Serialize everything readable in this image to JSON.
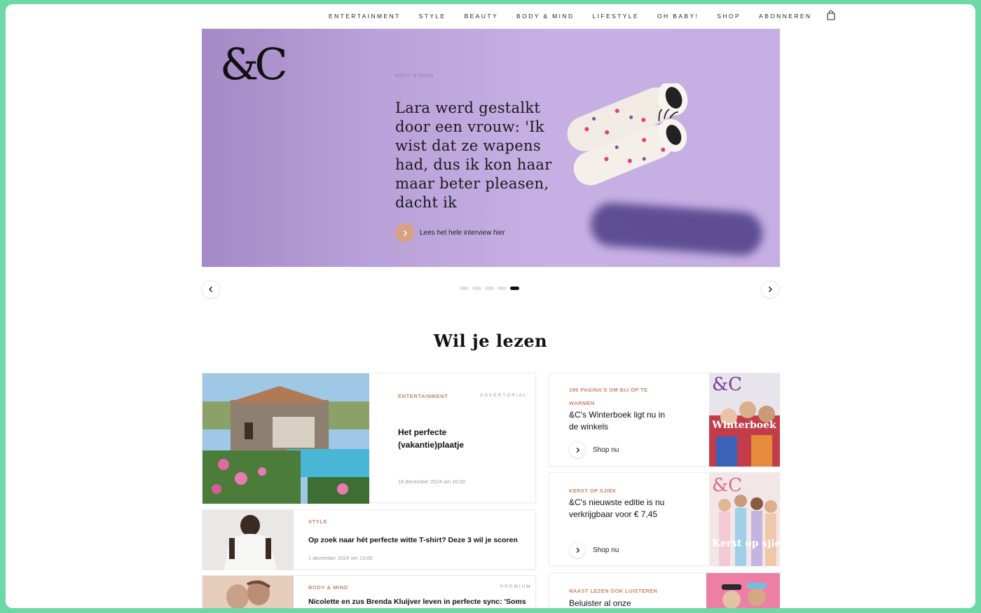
{
  "nav": {
    "items": [
      "ENTERTAINMENT",
      "STYLE",
      "BEAUTY",
      "BODY & MIND",
      "LIFESTYLE",
      "OH BABY!",
      "SHOP",
      "ABONNEREN"
    ],
    "cart_icon": "shopping-bag-icon"
  },
  "hero": {
    "logo": "&C",
    "kicker": "BODY & MIND",
    "headline": "Lara werd gestalkt door een vrouw: 'Ik wist dat ze wapens had, dus ik kon haar maar beter pleasen, dacht ik",
    "cta_label": "Lees het hele interview hier",
    "accent_color": "#d9a184"
  },
  "carousel": {
    "dot_count": 5,
    "active_index": 4
  },
  "section": {
    "title": "Wil je lezen"
  },
  "articles": [
    {
      "category": "ENTERTAINMENT",
      "tag": "ADVERTORIAL",
      "title": "Het perfecte (vakantie)plaatje",
      "date": "16 december 2024 om 16:00"
    },
    {
      "category": "STYLE",
      "tag": "",
      "title": "Op zoek naar hét perfecte witte T-shirt? Deze 3 wil je scoren",
      "date": "1 december 2024 om 13:00"
    },
    {
      "category": "BODY & MIND",
      "tag": "PREMIUM",
      "title": "Nicolette en zus Brenda Kluijver leven in perfecte sync: 'Soms",
      "date": ""
    }
  ],
  "promos": [
    {
      "category": "196 PAGINA'S OM BIJ OP TE WARMEN",
      "title": "&C's Winterboek ligt nu in de winkels",
      "cta": "Shop nu",
      "cover_title": "Winterboek"
    },
    {
      "category": "KERST OP SJIEK",
      "title": "&C's nieuwste editie is nu verkrijgbaar voor € 7,45",
      "cta": "Shop nu",
      "cover_title": "Kerst op sjiek"
    },
    {
      "category": "NAAST LEZEN OOK LUISTEREN",
      "title": "Beluister al onze",
      "cta": "",
      "cover_title": ""
    }
  ]
}
